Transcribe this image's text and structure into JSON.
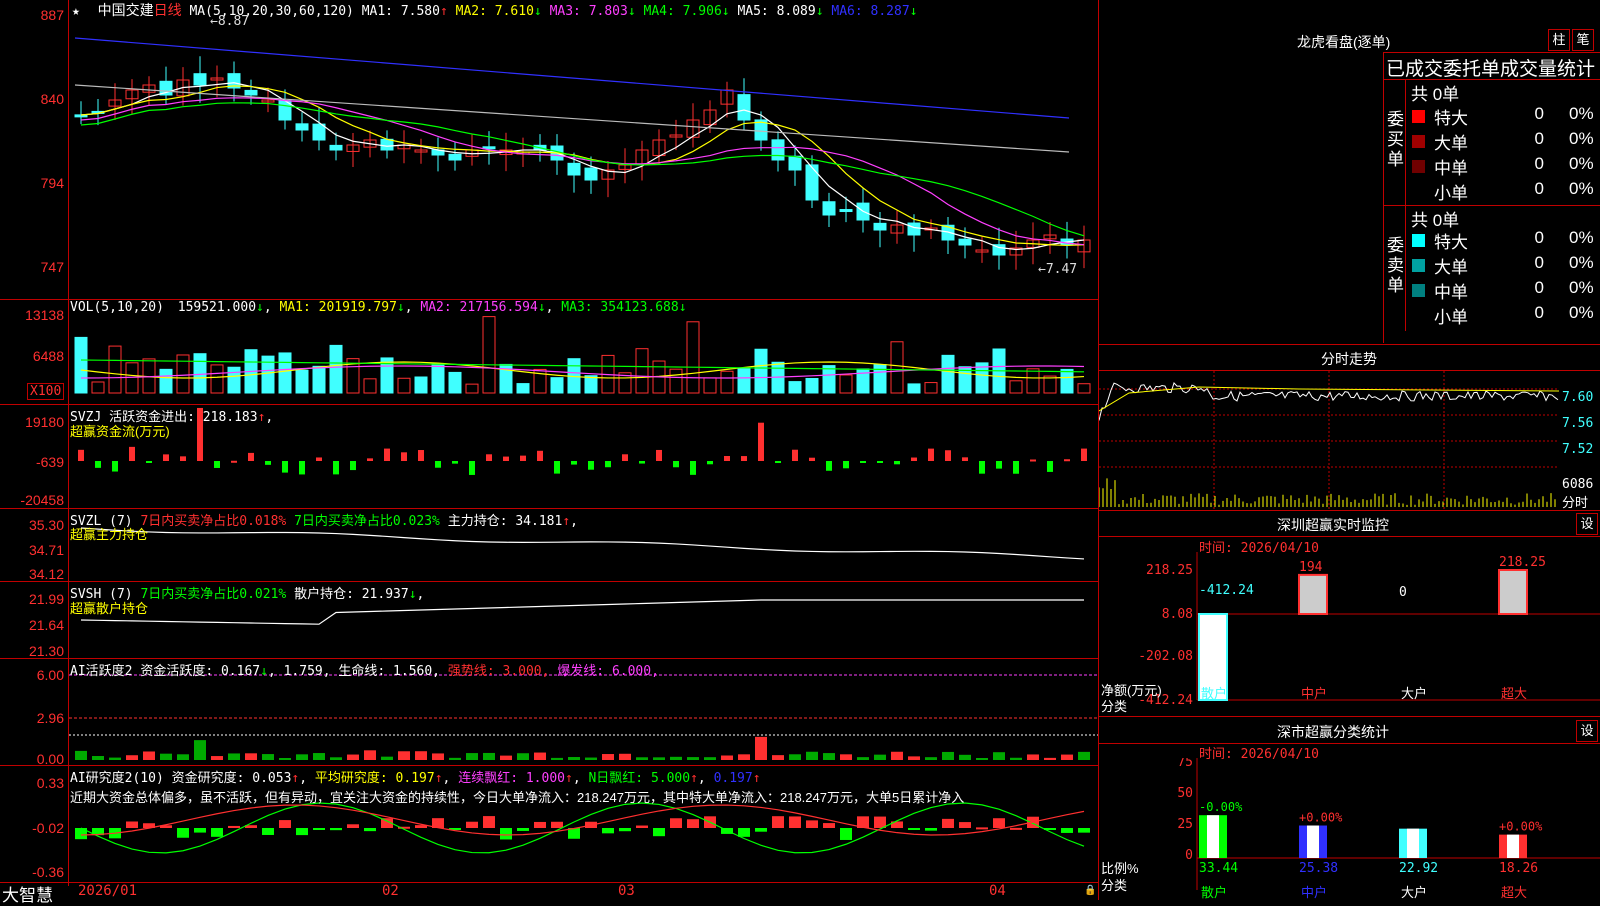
{
  "stock": {
    "star": "★",
    "name": "中国交建",
    "period": "日线"
  },
  "ma_header": {
    "label": "MA(5,10,20,30,60,120)",
    "ma1": "MA1: 7.580",
    "ma2": "MA2: 7.610",
    "ma3": "MA3: 7.803",
    "ma4": "MA4: 7.906",
    "ma5": "MA5: 8.089",
    "ma6": "MA6: 8.287",
    "hi_mark": "8.87",
    "lo_mark": "7.47"
  },
  "price_axis": [
    "887",
    "840",
    "794",
    "747"
  ],
  "vol_header": {
    "label": "VOL(5,10,20)",
    "val": "159521.000",
    "ma1": "MA1: 201919.797",
    "ma2": "MA2: 217156.594",
    "ma3": "MA3: 354123.688"
  },
  "vol_axis": [
    "13138",
    "6488",
    "X100"
  ],
  "svzj": {
    "label": "SVZJ  活跃资金进出: 218.183",
    "sub": "超赢资金流(万元)",
    "axis": [
      "19180",
      "-639",
      "-20458"
    ]
  },
  "svzl": {
    "label": "SVZL (7)",
    "a": "7日内买卖净占比0.018%",
    "b": "7日内买卖净占比0.023%",
    "c": "主力持仓: 34.181",
    "sub": "超赢主力持仓",
    "axis": [
      "35.30",
      "34.71",
      "34.12"
    ]
  },
  "svsh": {
    "label": "SVSH (7)",
    "a": "7日内买卖净占比0.021%",
    "c": "散户持仓: 21.937",
    "sub": "超赢散户持仓",
    "axis": [
      "21.99",
      "21.64",
      "21.30"
    ]
  },
  "ai1": {
    "label": "AI活跃度2",
    "a": "资金活跃度: 0.167",
    "b": "1.759,",
    "c": "生命线: 1.560,",
    "d": "强势线: 3.000,",
    "e": "爆发线: 6.000,",
    "axis": [
      "6.00",
      "2.96",
      "0.00"
    ]
  },
  "ai2": {
    "label": "AI研究度2(10)",
    "a": "资金研究度: 0.053",
    "b": "平均研究度: 0.197",
    "c": "连续飘红: 1.000",
    "d": "N日飘红: 5.000",
    "e": "0.197",
    "text": "近期大资金总体偏多，虽不活跃，但有异动，宜关注大资金的持续性，今日大单净流入：218.247万元，其中特大单净流入：218.247万元，大单5日累计净入",
    "axis": [
      "0.33",
      "-0.02",
      "-0.36"
    ]
  },
  "date_axis": {
    "logo": "大智慧",
    "d1": "2026/01",
    "d2": "02",
    "d3": "03",
    "d4": "04"
  },
  "dragon": {
    "title": "龙虎看盘(逐单)",
    "btn1": "柱",
    "btn2": "笔",
    "heading": "已成交委托单成交量统计",
    "buy": {
      "side": "委买单",
      "total": "共 0单",
      "rows": [
        {
          "name": "特大",
          "v": "0",
          "p": "0%",
          "c": "#ff0000"
        },
        {
          "name": "大单",
          "v": "0",
          "p": "0%",
          "c": "#a00000"
        },
        {
          "name": "中单",
          "v": "0",
          "p": "0%",
          "c": "#700000"
        },
        {
          "name": "小单",
          "v": "0",
          "p": "0%",
          "c": "#000000"
        }
      ]
    },
    "sell": {
      "side": "委卖单",
      "total": "共 0单",
      "rows": [
        {
          "name": "特大",
          "v": "0",
          "p": "0%",
          "c": "#00ffff"
        },
        {
          "name": "大单",
          "v": "0",
          "p": "0%",
          "c": "#00a0a0"
        },
        {
          "name": "中单",
          "v": "0",
          "p": "0%",
          "c": "#008080"
        },
        {
          "name": "小单",
          "v": "0",
          "p": "0%",
          "c": "#000000"
        }
      ]
    }
  },
  "minute": {
    "title": "分时走势",
    "axis": [
      "7.60",
      "7.56",
      "7.52"
    ],
    "vol": "6086",
    "vol2": "分时"
  },
  "sz_monitor": {
    "title": "深圳超赢实时监控",
    "btn": "设",
    "time": "时间: 2026/04/10",
    "axis": [
      "218.25",
      "8.08",
      "-202.08",
      "-412.24"
    ],
    "ylabel": "净额(万元)",
    "xlabel": "分类",
    "bars": [
      {
        "name": "散户",
        "value": "-412.24"
      },
      {
        "name": "中户",
        "value": "194"
      },
      {
        "name": "大户",
        "value": "0"
      },
      {
        "name": "超大",
        "value": "218.25"
      }
    ]
  },
  "sz_class": {
    "title": "深市超赢分类统计",
    "btn": "设",
    "time": "时间: 2026/04/10",
    "axis": [
      "75",
      "50",
      "25",
      "0"
    ],
    "ylabel": "比例%",
    "xlabel": "分类",
    "bars": [
      {
        "name": "散户",
        "value": "33.44",
        "chg": "-0.00%"
      },
      {
        "name": "中户",
        "value": "25.38",
        "chg": "+0.00%"
      },
      {
        "name": "大户",
        "value": "22.92",
        "chg": ""
      },
      {
        "name": "超大",
        "value": "18.26",
        "chg": "+0.00%"
      }
    ]
  }
}
